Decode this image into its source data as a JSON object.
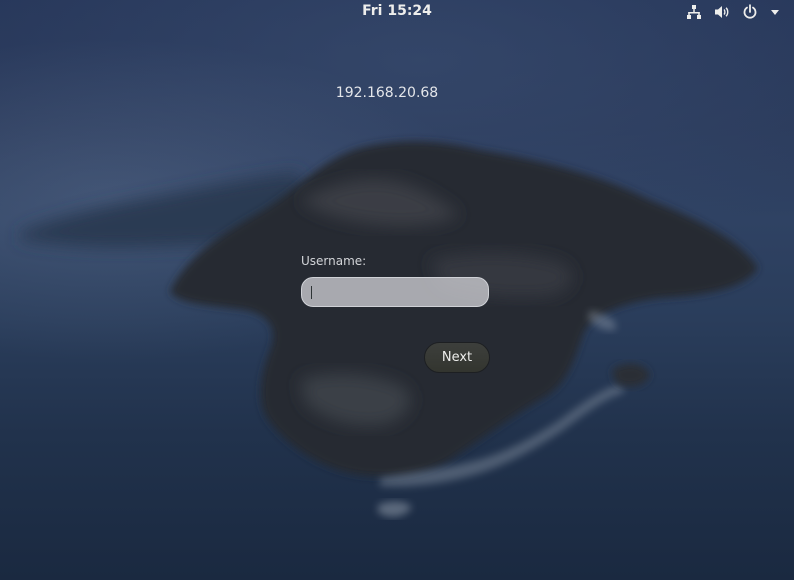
{
  "topbar": {
    "clock": "Fri 15:24",
    "indicators": [
      {
        "name": "network-icon"
      },
      {
        "name": "volume-icon"
      },
      {
        "name": "power-icon"
      },
      {
        "name": "system-menu-arrow-icon"
      }
    ]
  },
  "login": {
    "hostname": "192.168.20.68",
    "username_label": "Username:",
    "username_value": "",
    "next_label": "Next"
  },
  "colors": {
    "text": "#eeeeec",
    "input_background": "#cdcdd2",
    "button_background": "#3a3c38"
  }
}
